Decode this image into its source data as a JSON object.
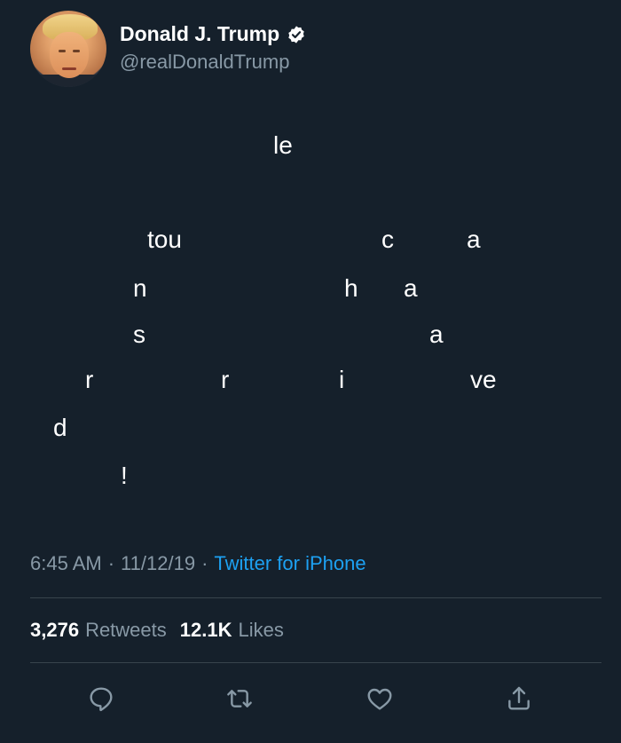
{
  "author": {
    "name": "Donald J. Trump",
    "handle": "@realDonaldTrump",
    "verified_icon": "verified-badge-icon"
  },
  "tweet": {
    "fragments": [
      {
        "text": "le"
      },
      {
        "text": "tou"
      },
      {
        "text": "c"
      },
      {
        "text": "a"
      },
      {
        "text": "n"
      },
      {
        "text": "h"
      },
      {
        "text": "a"
      },
      {
        "text": "s"
      },
      {
        "text": "a"
      },
      {
        "text": "r"
      },
      {
        "text": "r"
      },
      {
        "text": "i"
      },
      {
        "text": "ve"
      },
      {
        "text": "d"
      },
      {
        "text": "!"
      }
    ]
  },
  "meta": {
    "time": "6:45 AM",
    "date": "11/12/19",
    "separator": "·",
    "source": "Twitter for iPhone"
  },
  "stats": {
    "retweets_count": "3,276",
    "retweets_label": "Retweets",
    "likes_count": "12.1K",
    "likes_label": "Likes"
  },
  "actions": {
    "reply_icon": "reply-icon",
    "retweet_icon": "retweet-icon",
    "like_icon": "heart-icon",
    "share_icon": "share-icon"
  },
  "colors": {
    "background": "#15202b",
    "text": "#ffffff",
    "muted": "#8899a6",
    "link": "#1da1f2",
    "divider": "#38444d"
  }
}
